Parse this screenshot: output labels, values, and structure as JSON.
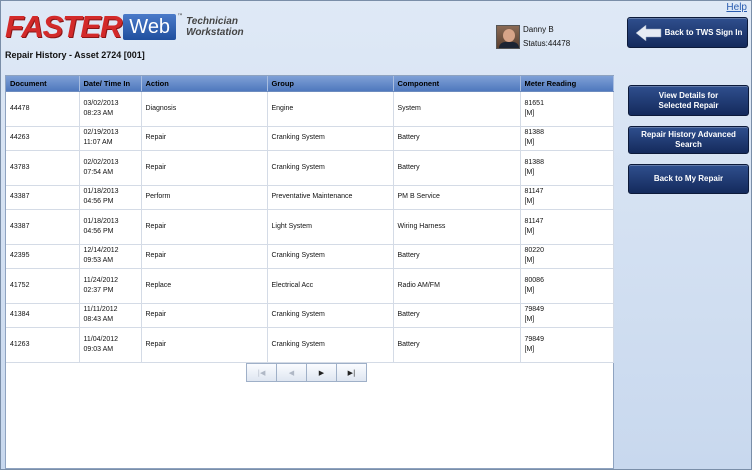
{
  "header": {
    "help_link": "Help",
    "logo_brand": "FASTER",
    "logo_web": "Web",
    "logo_tm": "™",
    "logo_sub_line1": "Technician",
    "logo_sub_line2": "Workstation",
    "page_title": "Repair History - Asset 2724 [001]"
  },
  "user": {
    "name": "Danny B",
    "status": "Status:44478"
  },
  "buttons": {
    "back_tws": "Back to TWS Sign In",
    "view_details_line1": "View Details for",
    "view_details_line2": "Selected Repair",
    "advanced_search": "Repair History Advanced Search",
    "back_my_repair": "Back to My Repair"
  },
  "table": {
    "columns": [
      "Document",
      "Date/ Time In",
      "Action",
      "Group",
      "Component",
      "Meter Reading"
    ],
    "rows": [
      {
        "document": "44478",
        "date": "03/02/2013",
        "time": "08:23 AM",
        "action": "Diagnosis",
        "group": "Engine",
        "component": "System",
        "meter": "81651",
        "unit": "[M]"
      },
      {
        "document": "44263",
        "date": "02/19/2013",
        "time": "11:07 AM",
        "action": "Repair",
        "group": "Cranking System",
        "component": "Battery",
        "meter": "81388",
        "unit": "[M]"
      },
      {
        "document": "43783",
        "date": "02/02/2013",
        "time": "07:54 AM",
        "action": "Repair",
        "group": "Cranking System",
        "component": "Battery",
        "meter": "81388",
        "unit": "[M]"
      },
      {
        "document": "43387",
        "date": "01/18/2013",
        "time": "04:56 PM",
        "action": "Perform",
        "group": "Preventative Maintenance",
        "component": "PM B Service",
        "meter": "81147",
        "unit": "[M]"
      },
      {
        "document": "43387",
        "date": "01/18/2013",
        "time": "04:56 PM",
        "action": "Repair",
        "group": "Light System",
        "component": "Wiring Harness",
        "meter": "81147",
        "unit": "[M]"
      },
      {
        "document": "42395",
        "date": "12/14/2012",
        "time": "09:53 AM",
        "action": "Repair",
        "group": "Cranking System",
        "component": "Battery",
        "meter": "80220",
        "unit": "[M]"
      },
      {
        "document": "41752",
        "date": "11/24/2012",
        "time": "02:37 PM",
        "action": "Replace",
        "group": "Electrical Acc",
        "component": "Radio AM/FM",
        "meter": "80086",
        "unit": "[M]"
      },
      {
        "document": "41384",
        "date": "11/11/2012",
        "time": "08:43 AM",
        "action": "Repair",
        "group": "Cranking System",
        "component": "Battery",
        "meter": "79849",
        "unit": "[M]"
      },
      {
        "document": "41263",
        "date": "11/04/2012",
        "time": "09:03 AM",
        "action": "Repair",
        "group": "Cranking System",
        "component": "Battery",
        "meter": "79849",
        "unit": "[M]"
      }
    ]
  },
  "pager": {
    "first": "|◀",
    "prev": "◀",
    "next": "▶",
    "last": "▶|"
  },
  "colors": {
    "brand_red": "#d32a2a",
    "button_navy": "#1f3a74",
    "header_blue": "#5b82c4"
  }
}
